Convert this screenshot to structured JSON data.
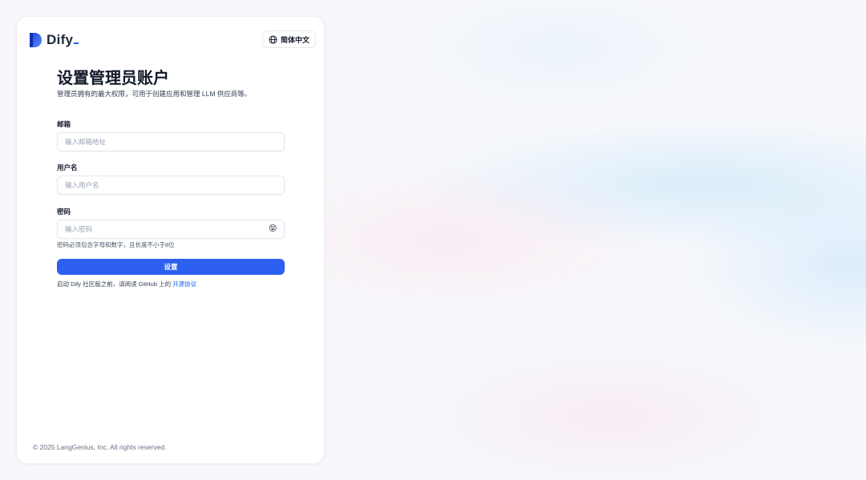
{
  "brand": {
    "name": "Dify",
    "accent": "#155eef"
  },
  "language": {
    "icon": "globe-icon",
    "label": "简体中文"
  },
  "heading": {
    "title": "设置管理员账户",
    "subtitle": "管理员拥有的最大权限，可用于创建应用和管理 LLM 供应商等。"
  },
  "form": {
    "email": {
      "label": "邮箱",
      "placeholder": "输入邮箱地址",
      "value": ""
    },
    "username": {
      "label": "用户名",
      "placeholder": "输入用户名",
      "value": ""
    },
    "password": {
      "label": "密码",
      "placeholder": "输入密码",
      "value": "",
      "toggle_icon": "😝",
      "hint": "密码必须包含字母和数字，且长度不小于8位"
    },
    "submit_label": "设置",
    "submit_color": "#2d5ff0"
  },
  "agreement": {
    "prefix": "启动 Dify 社区版之前，请阅读 GitHub 上的 ",
    "link": "开源协议"
  },
  "footer": {
    "copyright": "© 2025 LangGenius, Inc. All rights reserved."
  }
}
